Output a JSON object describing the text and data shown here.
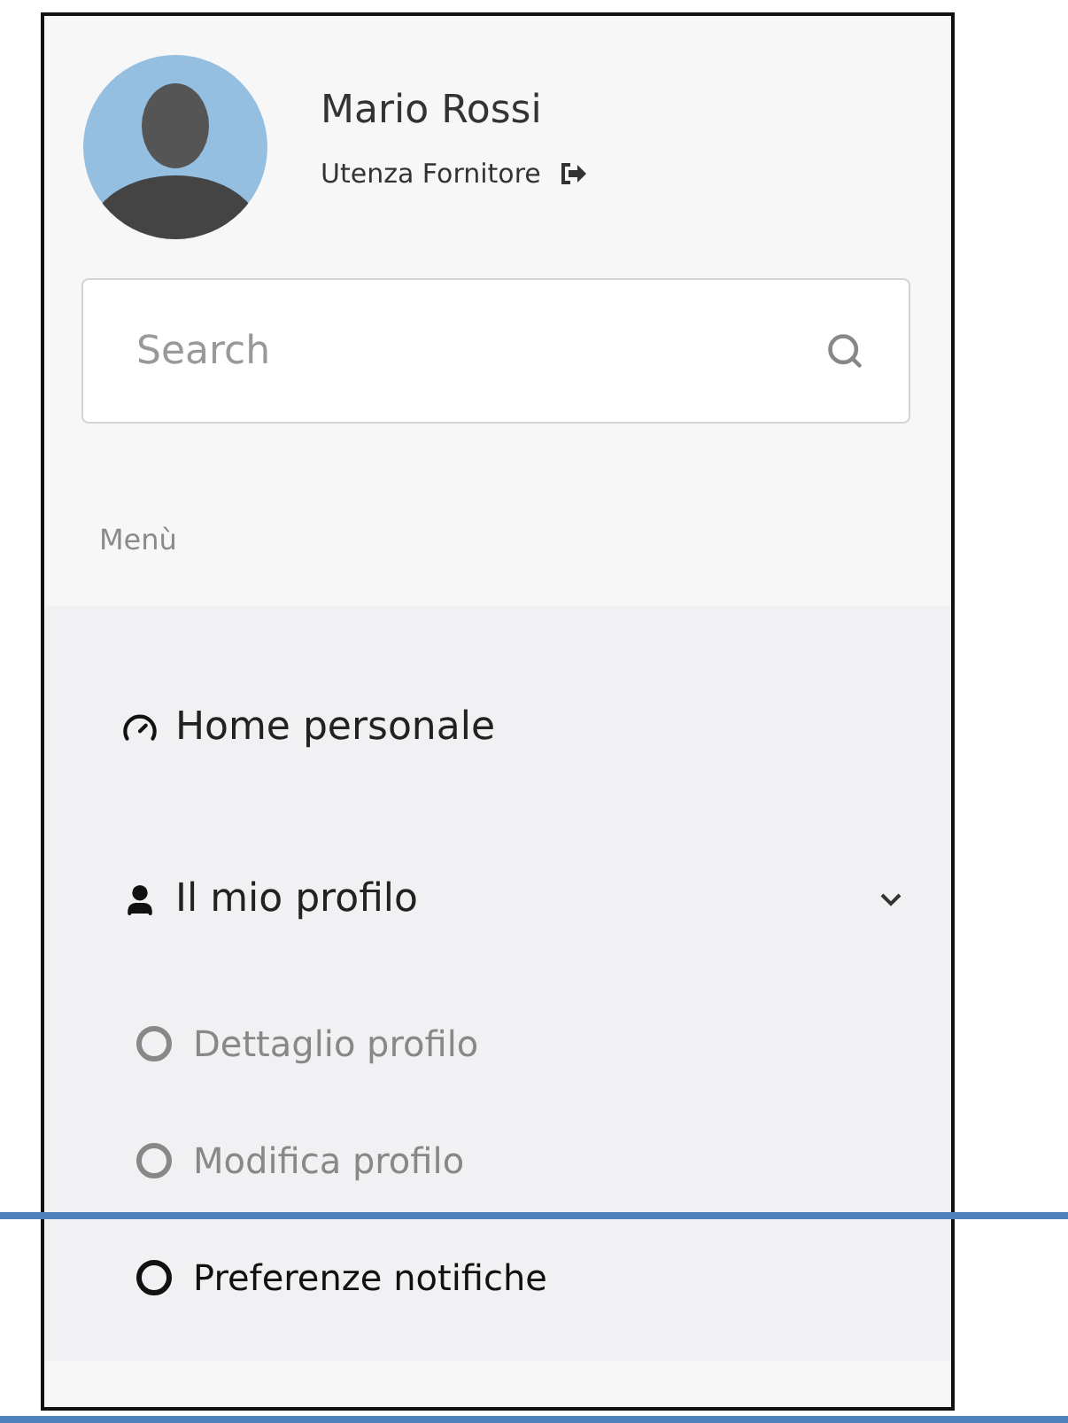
{
  "user": {
    "name": "Mario Rossi",
    "role": "Utenza Fornitore"
  },
  "search": {
    "placeholder": "Search"
  },
  "menu": {
    "heading": "Menù",
    "items": [
      {
        "label": "Home personale",
        "kind": "dashboard"
      },
      {
        "label": "Il mio profilo",
        "kind": "user",
        "expanded": true,
        "children": [
          {
            "label": "Dettaglio profilo",
            "selected": false
          },
          {
            "label": "Modifica profilo",
            "selected": false
          },
          {
            "label": "Preferenze notifiche",
            "selected": true
          }
        ]
      }
    ]
  }
}
